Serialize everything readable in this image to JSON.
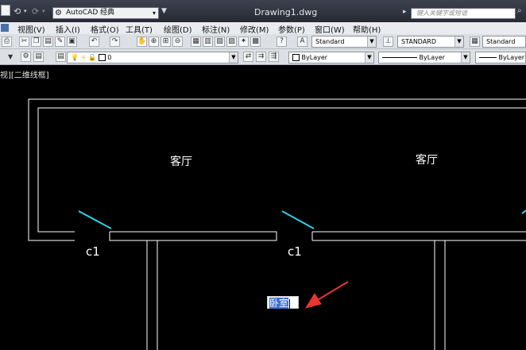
{
  "title_bar": {
    "workspace": "AutoCAD 经典",
    "document_title": "Drawing1.dwg",
    "search_placeholder": "键入关键字或短语"
  },
  "menu": {
    "items": [
      "视图(V)",
      "插入(I)",
      "格式(O)",
      "工具(T)",
      "绘图(D)",
      "标注(N)",
      "修改(M)",
      "参数(P)",
      "窗口(W)",
      "帮助(H)"
    ]
  },
  "styles_toolbar": {
    "text_style": "Standard",
    "dim_style": "STANDARD",
    "table_style": "Standard"
  },
  "layers_toolbar": {
    "layer_name": "0",
    "color": "ByLayer",
    "linetype": "ByLayer",
    "lineweight": "ByLayer"
  },
  "viewport": {
    "view_label": "视][二维线框]"
  },
  "drawing": {
    "room_labels": [
      "客厅",
      "客厅"
    ],
    "door_tags": [
      "c1",
      "c1"
    ],
    "edit_text": "卧室",
    "colors": {
      "background": "#000000",
      "walls": "#ffffff",
      "doors": "#2fd0e6",
      "arrow": "#e8372c"
    }
  }
}
